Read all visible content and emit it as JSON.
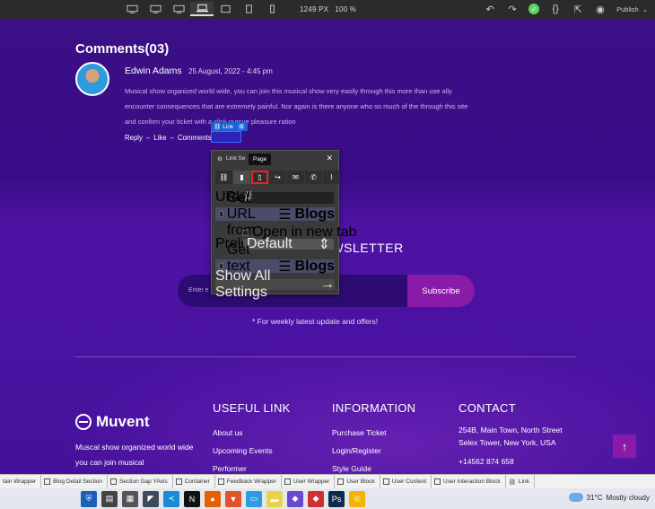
{
  "toolbar": {
    "devices": [
      "desktop-xl",
      "desktop-l",
      "desktop",
      "laptop",
      "tablet",
      "tablet-portrait",
      "mobile"
    ],
    "active_device": "laptop",
    "width": "1249",
    "width_unit": "PX",
    "zoom": "100 %",
    "publish_label": "Publish"
  },
  "page": {
    "comments_title": "Comments(03)",
    "comment": {
      "author": "Edwin Adams",
      "date": "25 August, 2022 - 4:45 pm",
      "body": "Musical show organized world wide, you can join this musical show very easily through this more than use ally encounter consequences that are extremely painful. Nor again is there anyone who so much of the through this site and confirm your ticket with a click pursue pleasure ration",
      "actions": [
        "Reply",
        "–",
        "Like",
        "–",
        "Comments"
      ]
    },
    "link_tag_label": "Link",
    "newsletter_title": "NEWSLETTER",
    "email_placeholder": "Enter e",
    "subscribe_label": "Subscribe",
    "newsletter_note": "* For weekly latest update and offers!",
    "footer": {
      "logo": "Muvent",
      "about": "Muscal show organized world wide you can join musical",
      "useful": {
        "heading": "USEFUL LINK",
        "items": [
          "About us",
          "Upcoming Events",
          "Performer"
        ]
      },
      "information": {
        "heading": "INFORMATION",
        "items": [
          "Purchase Ticket",
          "Login/Register",
          "Style Guide"
        ]
      },
      "contact": {
        "heading": "CONTACT",
        "address_line1": "254B, Main Town, North Street",
        "address_line2": "Selex Tower, New York, USA",
        "phone": "+14562 874 658"
      }
    }
  },
  "link_panel": {
    "title": "Link Se",
    "tooltip": "Page",
    "types": [
      "link",
      "page",
      "page-active",
      "anchor",
      "email",
      "phone",
      "attachment"
    ],
    "url_label": "URL",
    "url_value": "#",
    "get_url_label": "Get URL from",
    "source": "Blogs",
    "open_new_tab": "Open in new tab",
    "preload_label": "Preload",
    "preload_value": "Default",
    "get_text_label": "Get text from",
    "show_all": "Show All Settings"
  },
  "breadcrumbs": [
    "tain Wrapper",
    "Blog Detail Section",
    "Section Gap YAxis",
    "Container",
    "Feedback Wrapper",
    "User Wrapper",
    "User Block",
    "User Content",
    "User Interaction Block",
    "Link"
  ],
  "taskbar": {
    "temperature": "31°C",
    "condition": "Mostly cloudy"
  }
}
